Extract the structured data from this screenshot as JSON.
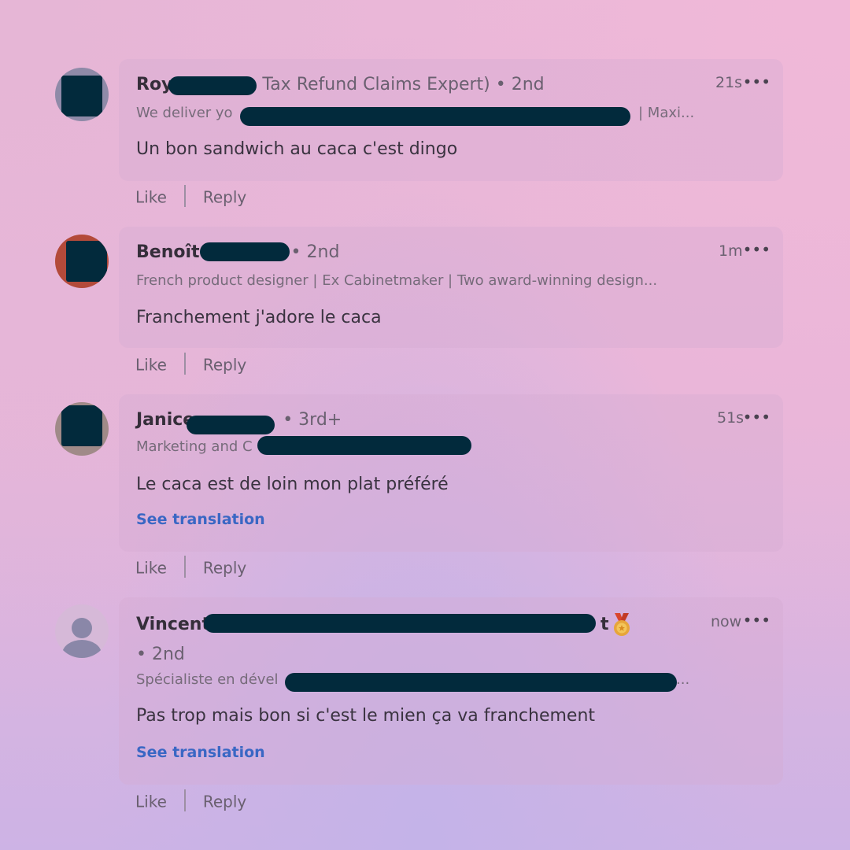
{
  "comments": [
    {
      "name": "Roy",
      "title_tail": "Tax Refund Claims Expert)",
      "degree": "• 2nd",
      "subtitle_start": "We deliver yo",
      "subtitle_end": "| Maxi...",
      "text": "Un bon sandwich au caca c'est dingo",
      "time": "21s"
    },
    {
      "name": "Benoît",
      "degree": "• 2nd",
      "subtitle": "French product designer | Ex Cabinetmaker | Two award-winning design...",
      "text": "Franchement j'adore le caca",
      "time": "1m"
    },
    {
      "name": "Janice",
      "degree": "• 3rd+",
      "subtitle_start": "Marketing and C",
      "text": "Le caca est de loin mon plat préféré",
      "translation_link": "See translation",
      "time": "51s"
    },
    {
      "name": "Vincent",
      "name_tail": "t",
      "degree": "• 2nd",
      "subtitle_start": "Spécialiste en dével",
      "subtitle_end": "...",
      "text": "Pas trop mais bon si c'est le mien ça va franchement",
      "translation_link": "See translation",
      "time": "now"
    }
  ],
  "actions": {
    "like_label": "Like",
    "reply_label": "Reply"
  },
  "more_label": "•••",
  "icons": {
    "medal": "medal-icon",
    "profile_placeholder": "person-icon"
  },
  "colors": {
    "redaction": "#022a3c",
    "link": "#3a67c4"
  }
}
